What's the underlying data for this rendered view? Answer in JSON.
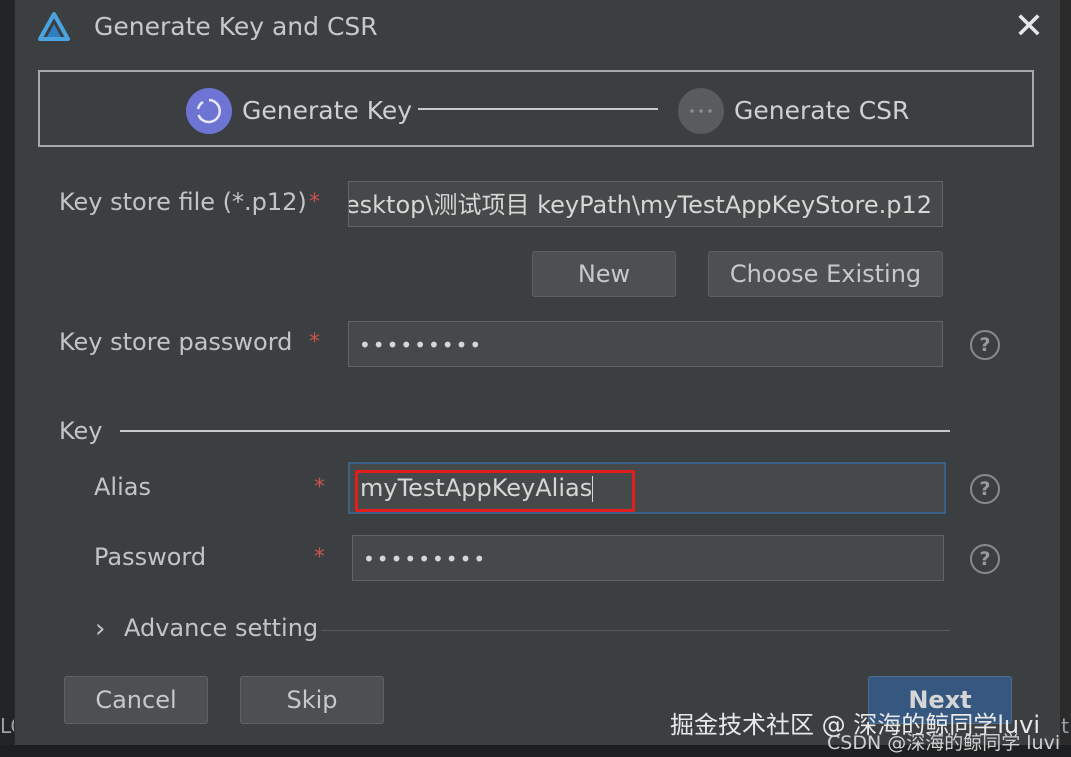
{
  "background": {
    "left_text": "LO",
    "right_text": "t"
  },
  "dialog": {
    "title": "Generate Key and CSR",
    "close_glyph": "✕"
  },
  "steps": [
    {
      "label": "Generate Key",
      "state": "active",
      "glyph": "◌"
    },
    {
      "label": "Generate CSR",
      "state": "inactive",
      "glyph": "···"
    }
  ],
  "keystore": {
    "file_label": "Key store file (*.p12)",
    "file_value": "esktop\\测试项目 keyPath\\myTestAppKeyStore.p12",
    "new_button": "New",
    "choose_existing_button": "Choose Existing",
    "password_label": "Key store password",
    "password_value": "•••••••••"
  },
  "key": {
    "section_label": "Key",
    "alias_label": "Alias",
    "alias_value": "myTestAppKeyAlias",
    "password_label": "Password",
    "password_value": "•••••••••"
  },
  "advance": {
    "label": "Advance setting",
    "chevron": "›"
  },
  "required_mark": "*",
  "help_glyph": "?",
  "footer": {
    "cancel": "Cancel",
    "skip": "Skip",
    "next": "Next"
  },
  "watermarks": {
    "line1": "掘金技术社区 @ 深海的鲸同学luvi",
    "line2": "CSDN @深海的鲸同学 luvi"
  },
  "colors": {
    "accent": "#6d74d4",
    "primary_button": "#365880",
    "required": "#c75450",
    "highlight": "#e21d1d"
  }
}
